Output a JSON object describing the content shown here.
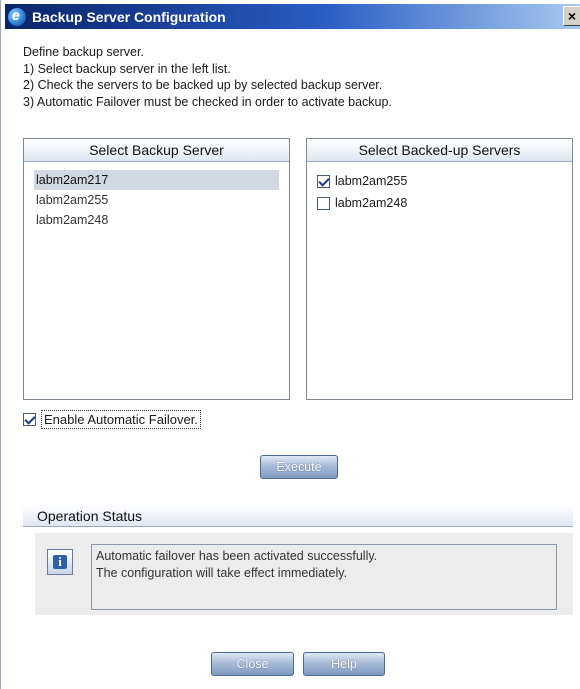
{
  "window": {
    "title": "Backup Server Configuration",
    "close_glyph": "×"
  },
  "instructions": {
    "lines": [
      "Define backup server.",
      "1) Select backup server in the left list.",
      "2) Check the servers to be backed up by selected backup server.",
      "3) Automatic Failover must be checked in order to activate backup."
    ]
  },
  "backup_panel": {
    "header": "Select Backup Server",
    "servers": [
      "labm2am217",
      "labm2am255",
      "labm2am248"
    ],
    "selected": "labm2am217"
  },
  "backed_panel": {
    "header": "Select Backed-up Servers",
    "servers": [
      {
        "label": "labm2am255",
        "checked": true
      },
      {
        "label": "labm2am248",
        "checked": false
      }
    ]
  },
  "failover": {
    "label": "Enable Automatic Failover.",
    "checked": true
  },
  "execute_label": "Execute",
  "status": {
    "header": "Operation Status",
    "icon": "info-icon",
    "messages": [
      "Automatic failover has been activated successfully.",
      "The configuration will take effect immediately."
    ]
  },
  "footer": {
    "close_label": "Close",
    "help_label": "Help"
  },
  "colors": {
    "title_bar_start": "#0a246a",
    "title_bar_end": "#a6caf0",
    "button_gradient": "#8aa4c8",
    "selection": "#d2d8e2"
  }
}
